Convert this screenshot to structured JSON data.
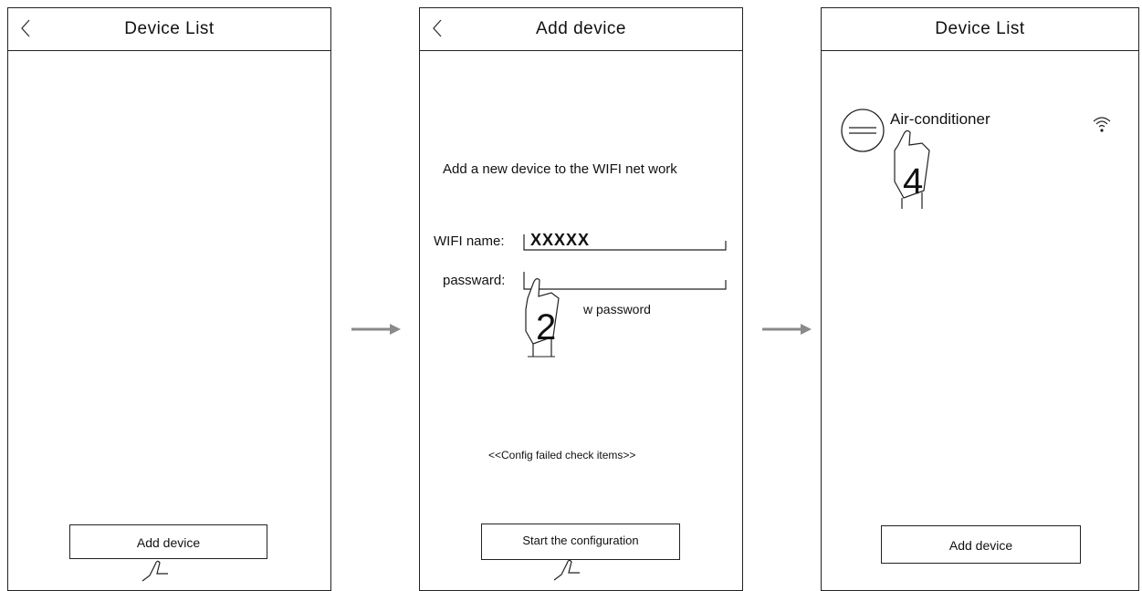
{
  "screen1": {
    "title": "Device List",
    "add_button": "Add device"
  },
  "screen2": {
    "title": "Add device",
    "instruction": "Add a new device to the WIFI net work",
    "wifi_label": "WIFI name:",
    "wifi_value": "XXXXX",
    "password_label": "passward:",
    "show_password": "w password",
    "config_failed": "<<Config failed check items>>",
    "start_button": "Start the configuration",
    "step_number": "2"
  },
  "screen3": {
    "title": "Device List",
    "device_name": "Air-conditioner",
    "add_button": "Add device",
    "step_number": "4"
  },
  "icons": {
    "back": "chevron-left-icon",
    "arrow": "right-arrow-icon",
    "hand": "pointing-hand-icon",
    "device": "air-conditioner-icon",
    "wifi": "wifi-signal-icon"
  }
}
